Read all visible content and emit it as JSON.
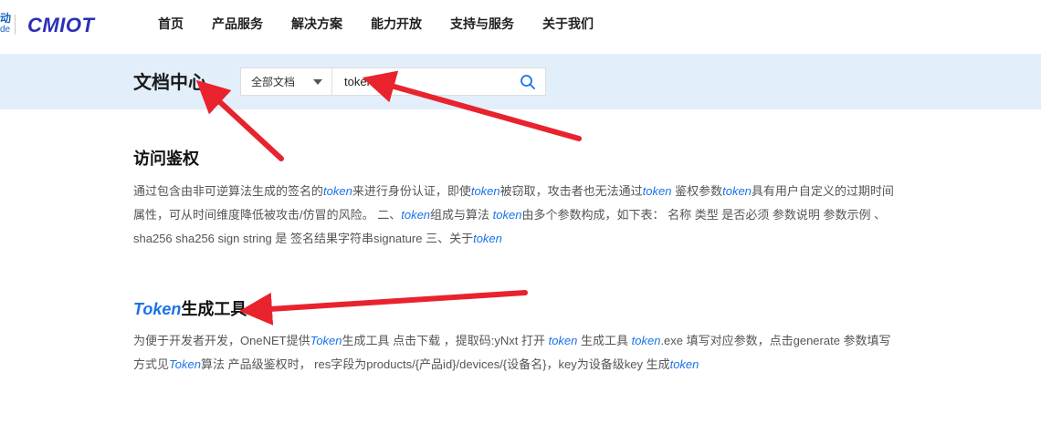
{
  "header": {
    "logo_partial_top": "动",
    "logo_partial_bottom": "de",
    "brand": "CMIOT",
    "nav": [
      "首页",
      "产品服务",
      "解决方案",
      "能力开放",
      "支持与服务",
      "关于我们"
    ]
  },
  "doc_center": {
    "title": "文档中心",
    "scope_selected": "全部文档",
    "search_value": "token"
  },
  "results": [
    {
      "title_parts": [
        {
          "text": "访问鉴权",
          "hl": false
        }
      ],
      "desc_parts": [
        {
          "text": "通过包含由非可逆算法生成的签名的",
          "hl": false
        },
        {
          "text": "token",
          "hl": true
        },
        {
          "text": "来进行身份认证，即使",
          "hl": false
        },
        {
          "text": "token",
          "hl": true
        },
        {
          "text": "被窃取，攻击者也无法通过",
          "hl": false
        },
        {
          "text": "token",
          "hl": true
        },
        {
          "text": " 鉴权参数",
          "hl": false
        },
        {
          "text": "token",
          "hl": true
        },
        {
          "text": "具有用户自定义的过期时间属性，可从时间维度降低被攻击/仿冒的风险。 二、",
          "hl": false
        },
        {
          "text": "token",
          "hl": true
        },
        {
          "text": "组成与算法 ",
          "hl": false
        },
        {
          "text": "token",
          "hl": true
        },
        {
          "text": "由多个参数构成，如下表： 名称 类型 是否必须 参数说明 参数示例 、sha256 sha256 sign string 是 签名结果字符串signature 三、关于",
          "hl": false
        },
        {
          "text": "token",
          "hl": true
        }
      ]
    },
    {
      "title_parts": [
        {
          "text": "Token",
          "hl": true
        },
        {
          "text": "生成工具",
          "hl": false
        }
      ],
      "desc_parts": [
        {
          "text": "为便于开发者开发，OneNET提供",
          "hl": false
        },
        {
          "text": "Token",
          "hl": true
        },
        {
          "text": "生成工具 点击下载 ，提取码:yNxt 打开 ",
          "hl": false
        },
        {
          "text": "token",
          "hl": true
        },
        {
          "text": " 生成工具 ",
          "hl": false
        },
        {
          "text": "token",
          "hl": true
        },
        {
          "text": ".exe 填写对应参数，点击generate 参数填写方式见",
          "hl": false
        },
        {
          "text": "Token",
          "hl": true
        },
        {
          "text": "算法 产品级鉴权时， res字段为products/{产品id}/devices/{设备名}，key为设备级key 生成",
          "hl": false
        },
        {
          "text": "token",
          "hl": true
        }
      ]
    }
  ],
  "colors": {
    "banner_bg": "#e3eefb",
    "highlight": "#1a73e8",
    "brand": "#2b2fb8",
    "annotation_arrow": "#e8232e"
  },
  "icons": {
    "search": "search-icon",
    "dropdown": "caret-down-icon"
  }
}
